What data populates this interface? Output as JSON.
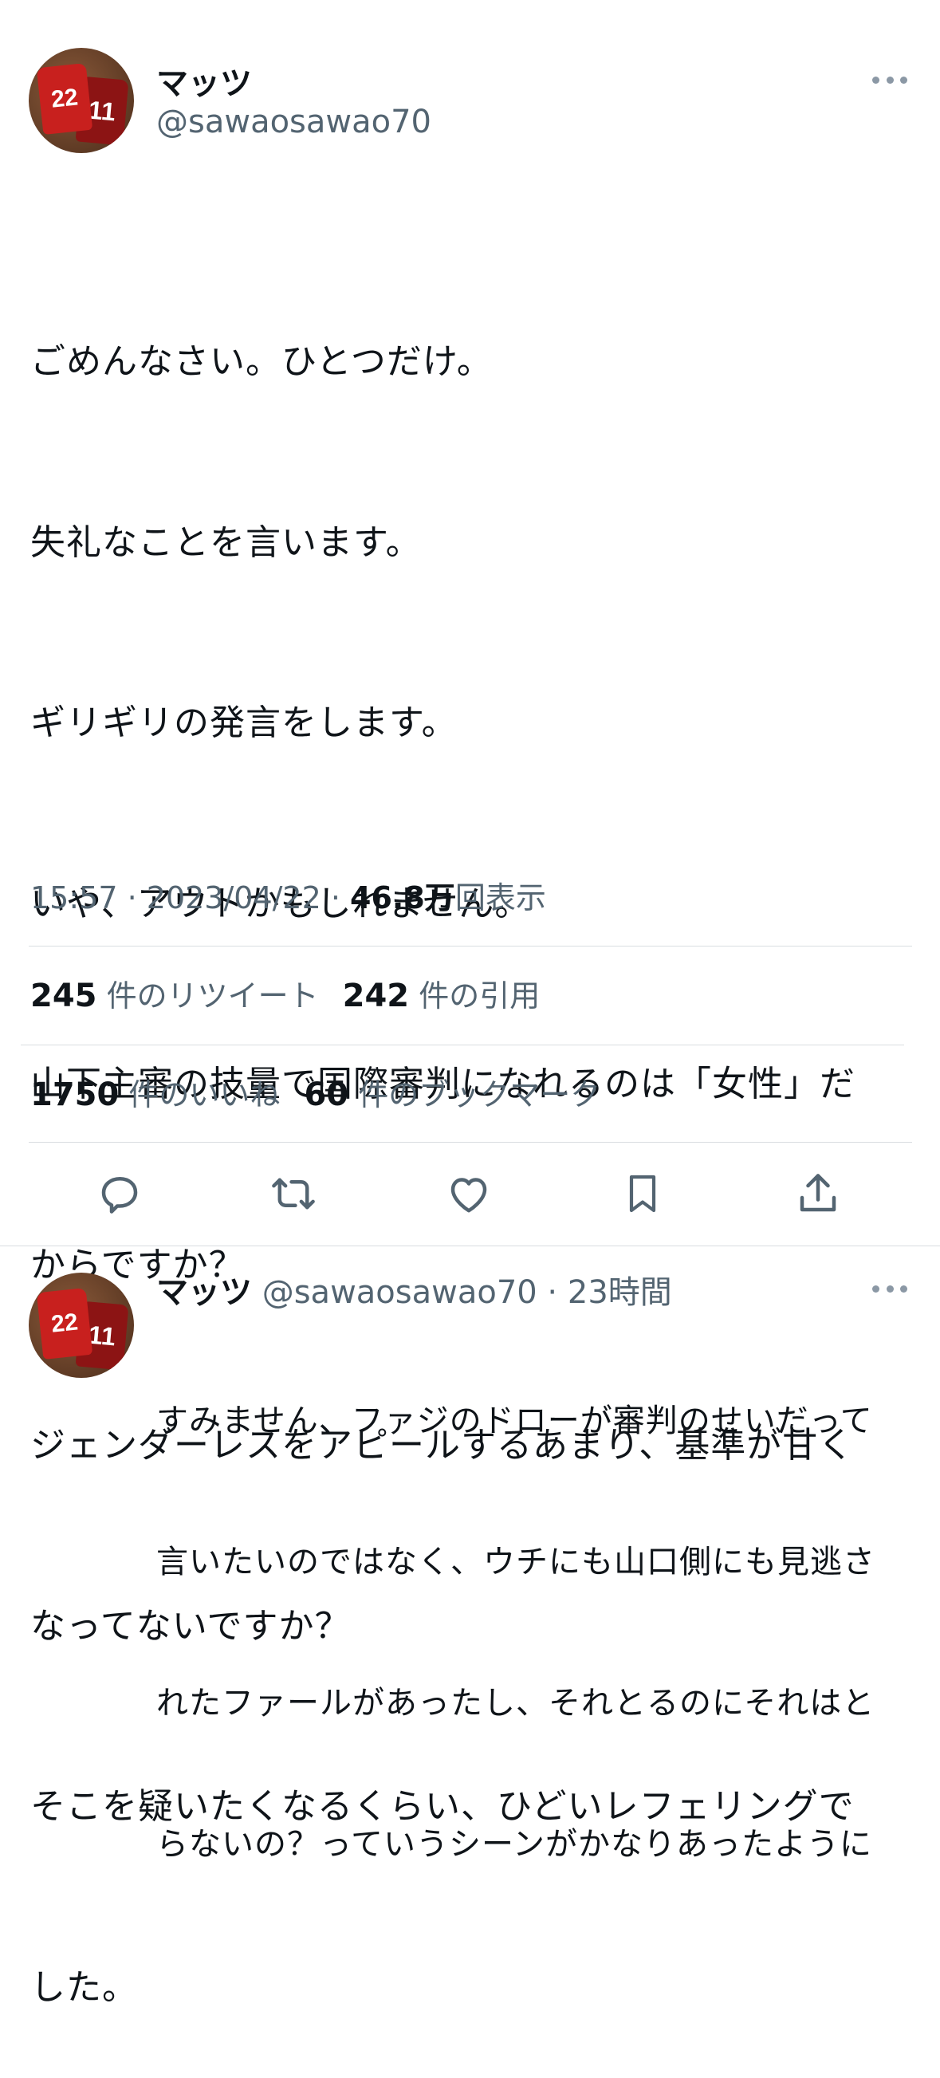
{
  "tweet": {
    "author_name": "マッツ",
    "author_handle": "@sawaosawao70",
    "avatar": {
      "jersey_front_number": "22",
      "jersey_back_number": "11"
    },
    "text_lines": [
      "ごめんなさい。ひとつだけ。",
      "失礼なことを言います。",
      "ギリギリの発言をします。",
      "いや、アウトかもしれません。",
      "山下主審の技量で国際審判になれるのは「女性」だ",
      "からですか？",
      "ジェンダーレスをアピールするあまり、基準が甘く",
      "なってないですか？",
      "そこを疑いたくなるくらい、ひどいレフェリングで",
      "した。"
    ],
    "time": "15:57",
    "date": "2023/04/22",
    "views": "46.8万",
    "views_label": "回表示",
    "retweets": "245",
    "retweets_label": "件のリツイート",
    "quotes": "242",
    "quotes_label": "件の引用",
    "likes": "1750",
    "likes_label": "件のいいね",
    "bookmarks": "60",
    "bookmarks_label": "件のブックマーク"
  },
  "actions": [
    "reply-icon",
    "retweet-icon",
    "like-icon",
    "bookmark-icon",
    "share-icon"
  ],
  "reply": {
    "author_name": "マッツ",
    "author_handle": "@sawaosawao70",
    "age": "23時間",
    "avatar": {
      "jersey_front_number": "22",
      "jersey_back_number": "11"
    },
    "text_lines": [
      "すみません、ファジのドローが審判のせいだって",
      "言いたいのではなく、ウチにも山口側にも見逃さ",
      "れたファールがあったし、それとるのにそれはと",
      "らないの？っていうシーンがかなりあったように"
    ]
  },
  "colors": {
    "text": "#0f1419",
    "secondary": "#536471",
    "divider": "#d9dde1"
  }
}
